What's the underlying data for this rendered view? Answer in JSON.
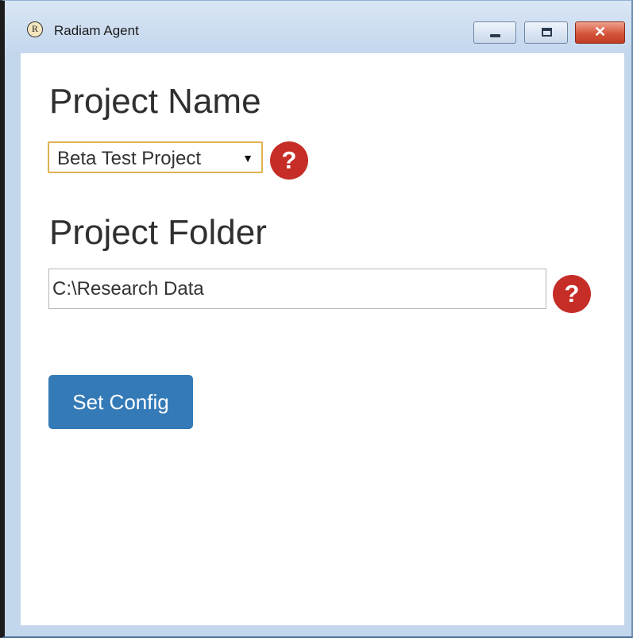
{
  "window": {
    "title": "Radiam Agent",
    "app_icon_glyph": "R",
    "app_icon": "radiam-logo-icon",
    "controls": {
      "minimize_icon": "minimize-icon",
      "maximize_icon": "maximize-icon",
      "close_icon": "close-icon",
      "close_glyph": "✕"
    }
  },
  "project_name": {
    "heading": "Project Name",
    "selected_value": "Beta Test Project",
    "dropdown_icon": "dropdown-arrow-icon",
    "dropdown_glyph": "▼",
    "help_icon": "help-icon",
    "help_glyph": "?"
  },
  "project_folder": {
    "heading": "Project Folder",
    "value": "C:\\Research Data",
    "help_icon": "help-icon",
    "help_glyph": "?"
  },
  "actions": {
    "set_config_label": "Set Config"
  },
  "colors": {
    "primary_button": "#337ab7",
    "help_badge": "#c62d27",
    "select_focus_border": "#e0b14f"
  }
}
